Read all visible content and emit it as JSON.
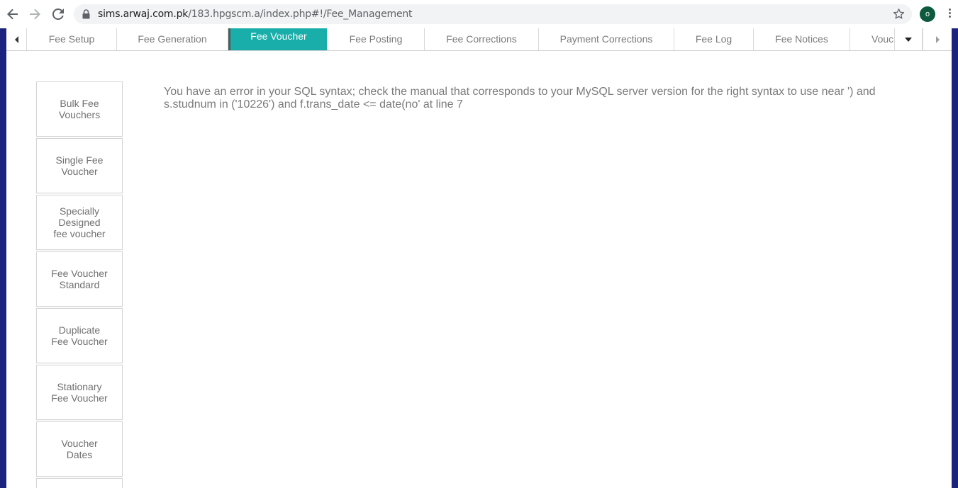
{
  "browser": {
    "url_host": "sims.arwaj.com.pk",
    "url_path": "/183.hpgscm.a/index.php#!/Fee_Management",
    "avatar_initial": "o"
  },
  "tabs": [
    {
      "label": "Fee Setup",
      "active": false
    },
    {
      "label": "Fee Generation",
      "active": false
    },
    {
      "label": "Fee Voucher",
      "active": true
    },
    {
      "label": "Fee Posting",
      "active": false
    },
    {
      "label": "Fee Corrections",
      "active": false
    },
    {
      "label": "Payment Corrections",
      "active": false
    },
    {
      "label": "Fee Log",
      "active": false
    },
    {
      "label": "Fee Notices",
      "active": false
    },
    {
      "label": "Vouc",
      "active": false
    }
  ],
  "sidemenu": [
    {
      "label": "Bulk Fee\nVouchers"
    },
    {
      "label": "Single Fee\nVoucher"
    },
    {
      "label": "Specially\nDesigned\nfee voucher"
    },
    {
      "label": "Fee Voucher\nStandard"
    },
    {
      "label": "Duplicate\nFee Voucher"
    },
    {
      "label": "Stationary\nFee Voucher"
    },
    {
      "label": "Voucher\nDates"
    }
  ],
  "error_message": "You have an error in your SQL syntax; check the manual that corresponds to your MySQL server version for the right syntax to use near ') and s.studnum in ('10226') and f.trans_date <= date(no' at line 7",
  "colors": {
    "active_tab": "#19aea9",
    "frame": "#1a237e",
    "avatar": "#0d5a3e"
  }
}
